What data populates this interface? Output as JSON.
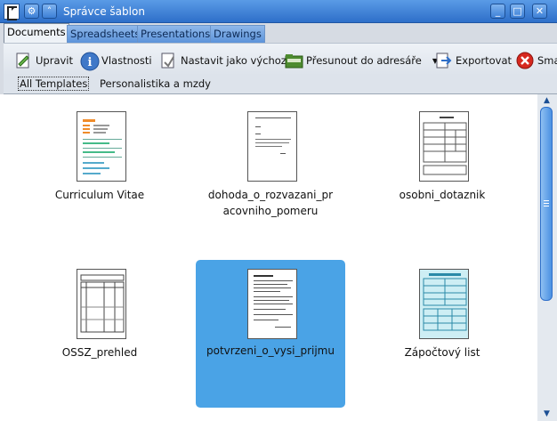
{
  "window": {
    "title": "Správce šablon",
    "menu_icon": "document-app-icon",
    "titlebar_buttons": [
      "gear-icon",
      "chevron-up-icon"
    ],
    "window_controls": [
      "minimize-icon",
      "maximize-icon",
      "close-icon"
    ]
  },
  "tabs": [
    {
      "label": "Documents",
      "active": true
    },
    {
      "label": "Spreadsheets",
      "active": false
    },
    {
      "label": "Presentations",
      "active": false
    },
    {
      "label": "Drawings",
      "active": false
    }
  ],
  "toolbar": [
    {
      "label": "Upravit",
      "icon": "edit-document-icon"
    },
    {
      "label": "Vlastnosti",
      "icon": "info-icon"
    },
    {
      "label": "Nastavit jako výchozí",
      "icon": "set-default-icon"
    },
    {
      "label": "Přesunout do adresáře",
      "icon": "move-to-folder-icon",
      "dropdown": true
    },
    {
      "label": "Exportovat",
      "icon": "export-icon"
    },
    {
      "label": "Sma",
      "icon": "delete-icon"
    }
  ],
  "filters": [
    {
      "label": "All Templates",
      "active": true
    },
    {
      "label": "Personalistika a mzdy",
      "active": false
    }
  ],
  "templates": [
    {
      "label": "Curriculum Vitae",
      "selected": false
    },
    {
      "label": "dohoda_o_rozvazani_pracovniho_pomeru",
      "label_lines": [
        "dohoda_o_rozvazani_pr",
        "acovniho_pomeru"
      ],
      "selected": false
    },
    {
      "label": "osobni_dotaznik",
      "selected": false
    },
    {
      "label": "OSSZ_prehled",
      "selected": false
    },
    {
      "label": "potvrzeni_o_vysi_prijmu",
      "selected": true
    },
    {
      "label": "Zápočtový list",
      "selected": false
    }
  ],
  "colors": {
    "titlebar": "#2e6fc9",
    "selection": "#4aa3e6",
    "tab_inactive": "#5c93da"
  }
}
